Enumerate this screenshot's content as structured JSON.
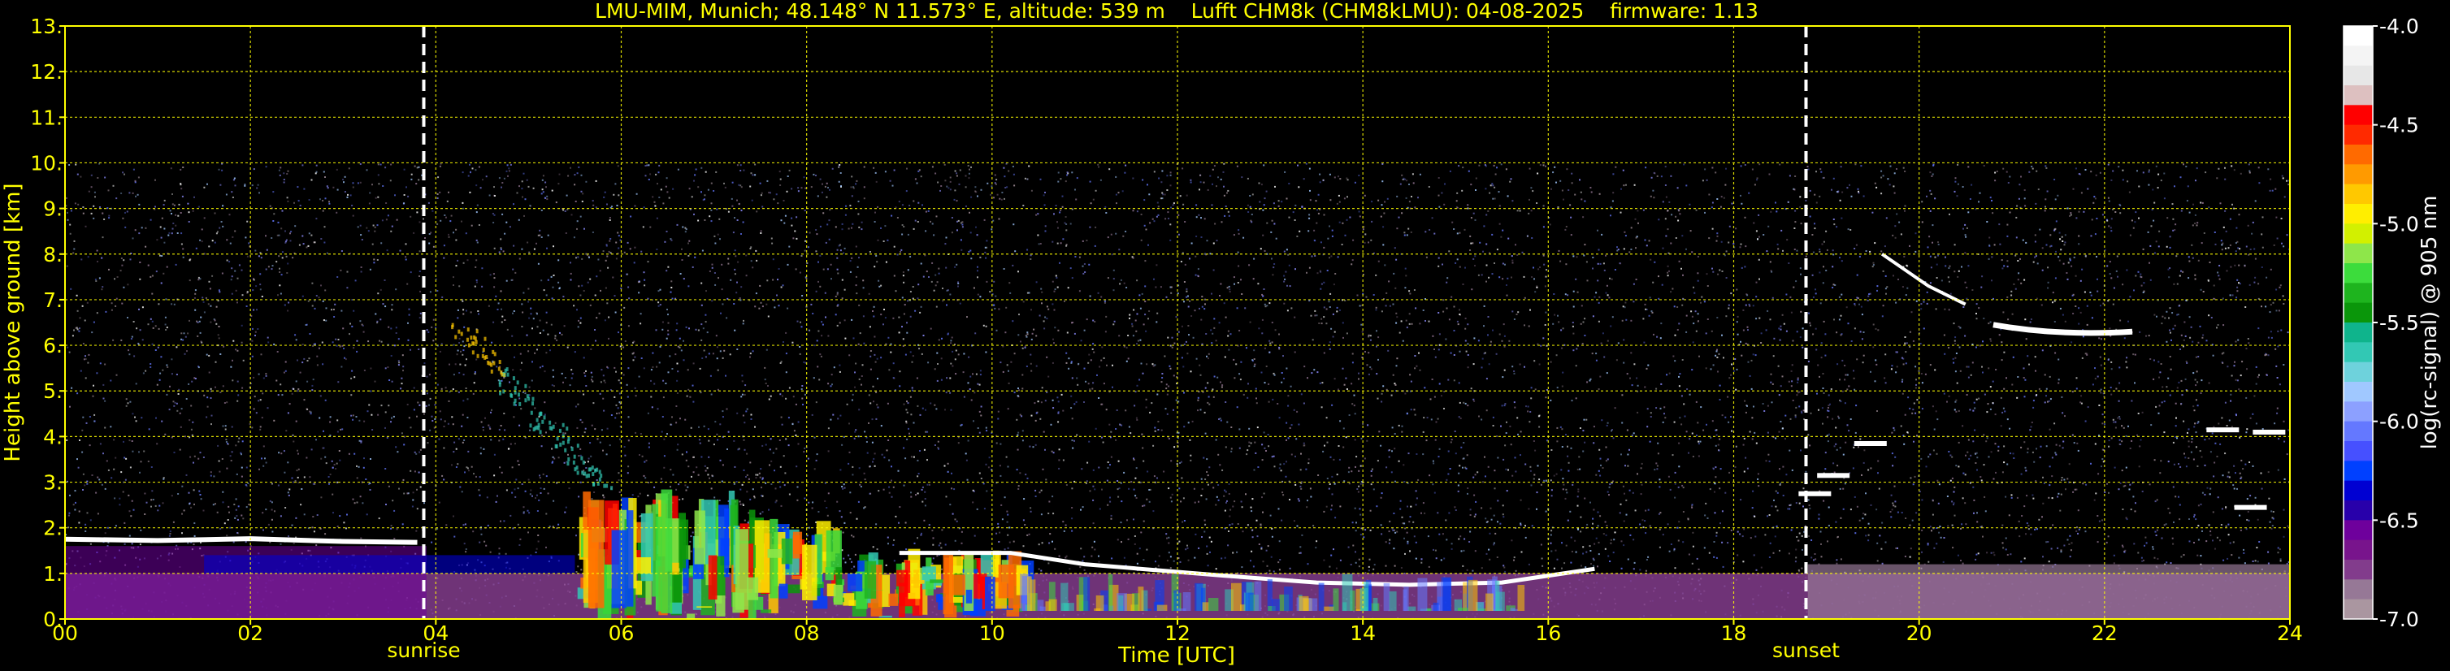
{
  "chart_data": {
    "type": "heatmap",
    "title": "LMU-MIM, Munich; 48.148° N 11.573° E, altitude: 539 m    Lufft CHM8k (CHM8kLMU): 04-08-2025    firmware: 1.13",
    "xlabel": "Time [UTC]",
    "ylabel": "Height above ground [km]",
    "xlim": [
      0,
      24
    ],
    "ylim": [
      0,
      13
    ],
    "x_ticks": [
      0,
      2,
      4,
      6,
      8,
      10,
      12,
      14,
      16,
      18,
      20,
      22,
      24
    ],
    "x_tick_labels": [
      "00",
      "02",
      "04",
      "06",
      "08",
      "10",
      "12",
      "14",
      "16",
      "18",
      "20",
      "22",
      "24"
    ],
    "y_ticks": [
      0,
      1,
      2,
      3,
      4,
      5,
      6,
      7,
      8,
      9,
      10,
      11,
      12,
      13
    ],
    "y_tick_labels": [
      "0.",
      "1.",
      "2.",
      "3.",
      "4.",
      "5.",
      "6.",
      "7.",
      "8.",
      "9.",
      "10.",
      "11.",
      "12.",
      "13."
    ],
    "grid": true,
    "data_top_km": 10,
    "markers": [
      {
        "label": "sunrise",
        "x": 3.87
      },
      {
        "label": "sunset",
        "x": 18.78
      }
    ],
    "colorbar": {
      "label": "log(rc-signal) @ 905 nm",
      "range": [
        -7.0,
        -4.0
      ],
      "ticks": [
        -4.0,
        -4.5,
        -5.0,
        -5.5,
        -6.0,
        -6.5,
        -7.0
      ],
      "tick_labels": [
        "-4.0",
        "-4.5",
        "-5.0",
        "-5.5",
        "-6.0",
        "-6.5",
        "-7.0"
      ],
      "colors_top_to_bottom": [
        "#ffffff",
        "#f4f4f4",
        "#e7e7e7",
        "#ddc0c0",
        "#ff0000",
        "#ff2a00",
        "#ff6a00",
        "#ff9a00",
        "#ffc800",
        "#ffee00",
        "#d2f000",
        "#8ee64a",
        "#3cdc3c",
        "#1eb41e",
        "#0a960a",
        "#0fb48c",
        "#32c8b4",
        "#6ed2dc",
        "#a0c8ff",
        "#8ca0ff",
        "#6478ff",
        "#4650ff",
        "#0040ff",
        "#0000d2",
        "#2800aa",
        "#6e009c",
        "#78148c",
        "#823c8c",
        "#967896",
        "#aa96a0"
      ]
    },
    "features": [
      {
        "name": "aerosol layer",
        "x": [
          0,
          3.87
        ],
        "height_km": 1.7
      },
      {
        "name": "convective boundary layer",
        "x": [
          5.5,
          10.3
        ],
        "height_km": [
          0,
          3.0
        ]
      },
      {
        "name": "boundary layer top",
        "x": [
          10.3,
          15.5
        ],
        "height_km": [
          0.75,
          1.45
        ]
      },
      {
        "name": "cloud layer",
        "x": [
          20.7,
          22.3
        ],
        "height_km": [
          6.2,
          6.5
        ]
      }
    ]
  }
}
